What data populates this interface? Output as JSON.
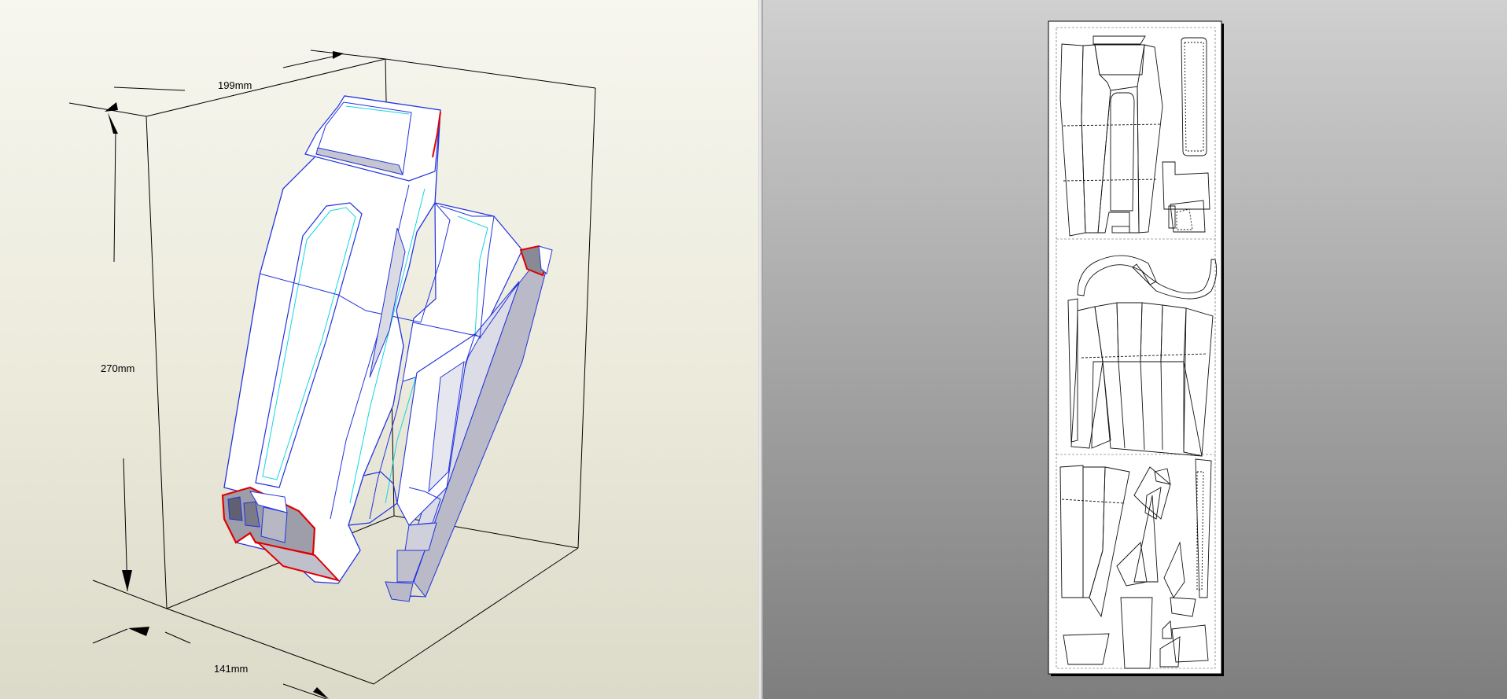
{
  "view3d": {
    "dimensions": {
      "width": "199mm",
      "height": "270mm",
      "depth": "141mm"
    }
  },
  "view2d": {
    "sheet_count": 1
  }
}
